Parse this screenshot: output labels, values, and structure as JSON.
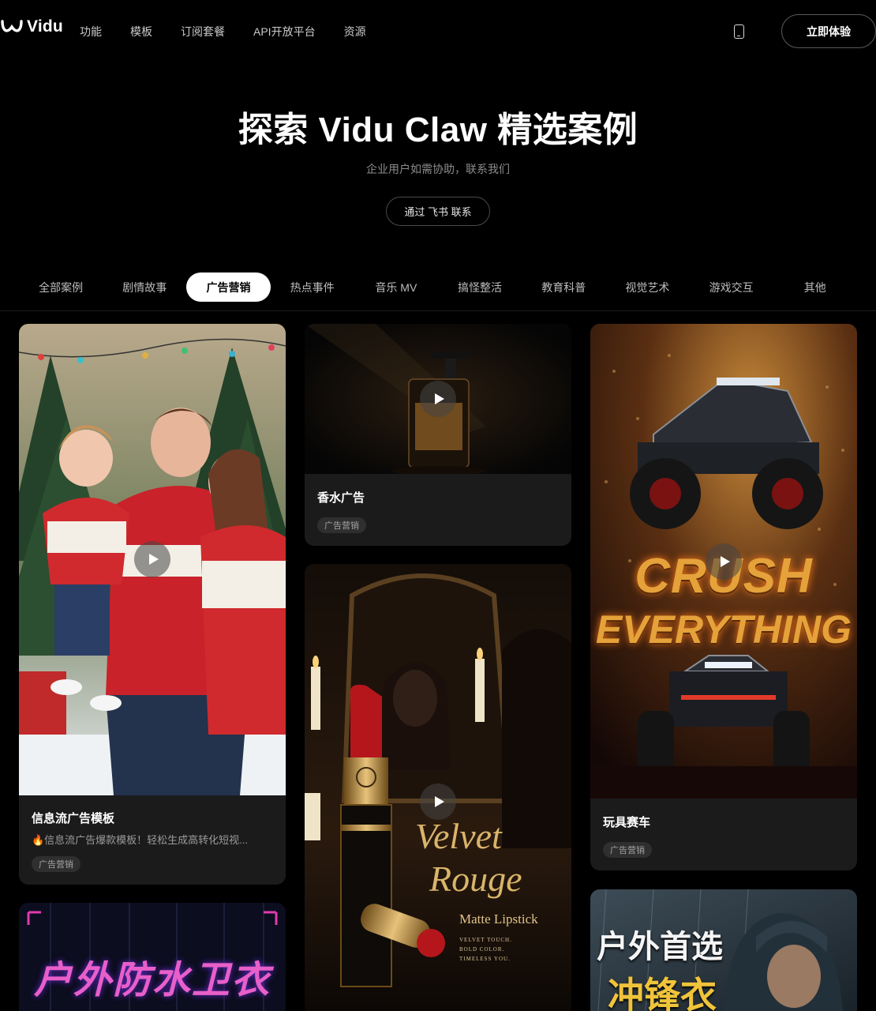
{
  "nav": {
    "logo_text": "Vidu",
    "links": [
      "功能",
      "模板",
      "订阅套餐",
      "API开放平台",
      "资源"
    ],
    "phone_icon": "mobile-phone-icon",
    "try_button": "立即体验"
  },
  "hero": {
    "title": "探索 Vidu Claw 精选案例",
    "subtitle": "企业用户如需协助，联系我们",
    "contact_button": "通过 飞书 联系"
  },
  "tabs": [
    "全部案例",
    "剧情故事",
    "广告营销",
    "热点事件",
    "音乐 MV",
    "搞怪整活",
    "教育科普",
    "视觉艺术",
    "游戏交互",
    "其他"
  ],
  "active_tab": "广告营销",
  "cards": {
    "christmas": {
      "title": "信息流广告模板",
      "desc": "🔥信息流广告爆款模板！轻松生成高转化短视...",
      "tag": "广告营销"
    },
    "perfume": {
      "title": "香水广告",
      "tag": "广告营销"
    },
    "lipstick": {
      "line1": "Velvet",
      "line2": "Rouge",
      "line3": "Matte Lipstick",
      "small1": "VELVET TOUCH.",
      "small2": "BOLD COLOR.",
      "small3": "TIMELESS YOU."
    },
    "car": {
      "title": "玩具赛车",
      "tag": "广告营销",
      "line1": "CRUSH",
      "line2": "EVERYTHING"
    },
    "raincoat": {
      "text": "户外防水卫衣"
    },
    "jacket": {
      "line1": "户外首选",
      "line2": "冲锋衣"
    }
  },
  "colors": {
    "accent": "#ffffff",
    "background": "#000000",
    "card": "#1b1b1b"
  }
}
